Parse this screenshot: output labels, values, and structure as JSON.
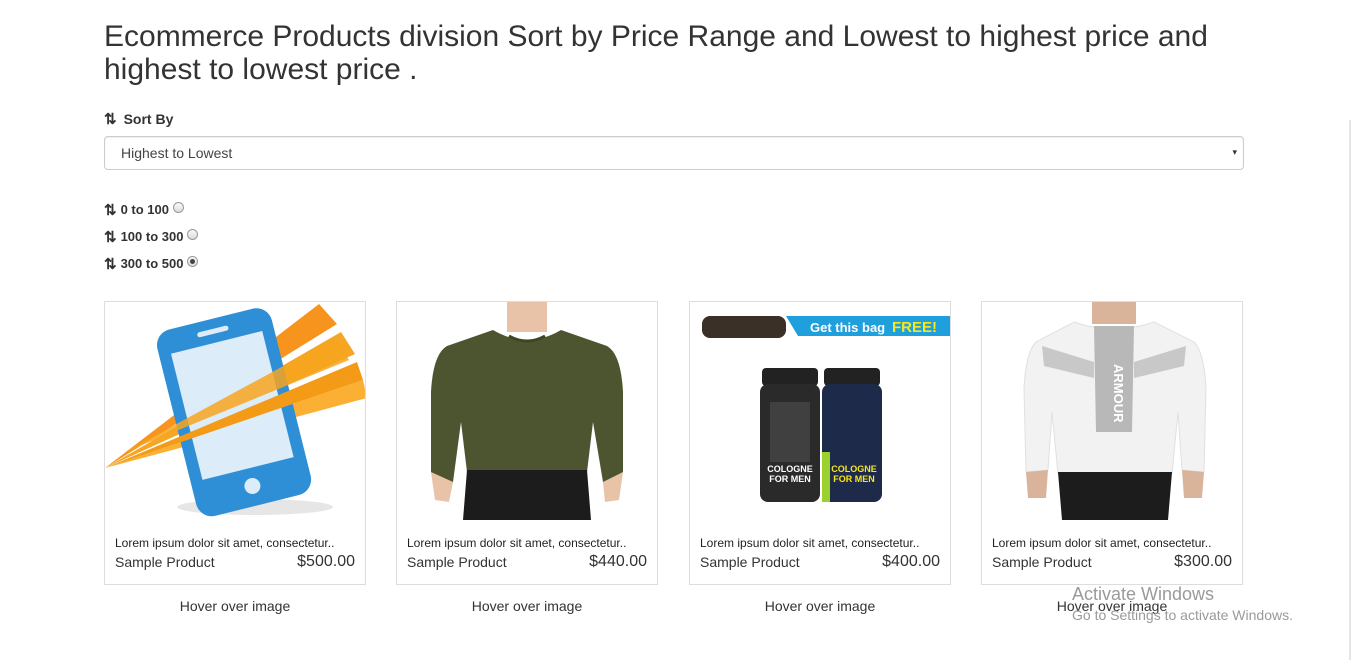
{
  "page": {
    "title": "Ecommerce Products division Sort by Price Range and Lowest to highest price and highest to lowest price ."
  },
  "sort": {
    "icon": "sort-arrows-icon",
    "icon_glyph": "⇅",
    "label": "Sort By",
    "selected": "Highest to Lowest",
    "caret": "▾"
  },
  "ranges": [
    {
      "label": "0 to 100",
      "checked": false
    },
    {
      "label": "100 to 300",
      "checked": false
    },
    {
      "label": "300 to 500",
      "checked": true
    }
  ],
  "products": [
    {
      "image": "smartphone-logo-image",
      "description": "Lorem ipsum dolor sit amet, consectetur..",
      "name": "Sample Product",
      "price": "$500.00",
      "hover": "Hover over image"
    },
    {
      "image": "green-tshirt-image",
      "description": "Lorem ipsum dolor sit amet, consectetur..",
      "name": "Sample Product",
      "price": "$440.00",
      "hover": "Hover over image"
    },
    {
      "image": "cologne-bottles-image",
      "banner": "Get this bag FREE!",
      "banner_text": "Get this bag",
      "banner_bold": "FREE!",
      "can1": [
        "COLOGNE",
        "FOR MEN"
      ],
      "can2": [
        "COLOGNE",
        "FOR MEN"
      ],
      "description": "Lorem ipsum dolor sit amet, consectetur..",
      "name": "Sample Product",
      "price": "$400.00",
      "hover": "Hover over image"
    },
    {
      "image": "white-tshirt-image",
      "shirt_text": "ARMOUR",
      "description": "Lorem ipsum dolor sit amet, consectetur..",
      "name": "Sample Product",
      "price": "$300.00",
      "hover": "Hover over image"
    }
  ],
  "watermark": {
    "line1": "Activate Windows",
    "line2": "Go to Settings to activate Windows."
  },
  "colors": {
    "text": "#333333",
    "border": "#dddddd",
    "phone_blue": "#2f8fd6",
    "orange": "#f39a16",
    "banner_blue": "#1fa0dc",
    "banner_yellow": "#f8e71c"
  }
}
